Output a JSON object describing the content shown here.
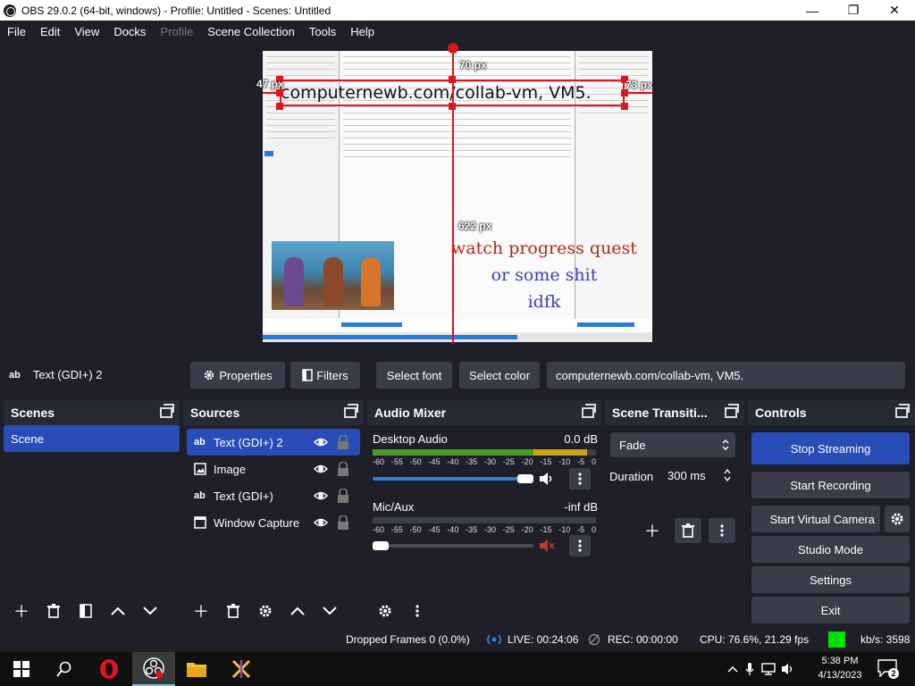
{
  "titlebar": {
    "title": "OBS 29.0.2 (64-bit, windows) - Profile: Untitled - Scenes: Untitled",
    "minimize": "—",
    "maximize": "❐",
    "close": "✕"
  },
  "menu": {
    "file": "File",
    "edit": "Edit",
    "view": "View",
    "docks": "Docks",
    "profile": "Profile",
    "scene_collection": "Scene Collection",
    "tools": "Tools",
    "help": "Help"
  },
  "preview": {
    "text_source": "computernewb.com/collab-vm, VM5.",
    "overlay_line1": "watch progress quest",
    "overlay_line2": "or some shit",
    "overlay_line3": "idfk",
    "dim_top": "70 px",
    "dim_left": "47 px",
    "dim_right": "73 px",
    "dim_bottom": "622 px"
  },
  "source_toolbar": {
    "source_type_icon": "ab",
    "source_name": "Text (GDI+) 2",
    "properties": "Properties",
    "filters": "Filters",
    "select_font": "Select font",
    "select_color": "Select color",
    "text_value": "computernewb.com/collab-vm, VM5."
  },
  "scenes": {
    "header": "Scenes",
    "items": [
      "Scene"
    ]
  },
  "sources": {
    "header": "Sources",
    "items": [
      {
        "name": "Text (GDI+) 2",
        "icon": "ab"
      },
      {
        "name": "Image",
        "icon": "image-icon"
      },
      {
        "name": "Text (GDI+)",
        "icon": "ab"
      },
      {
        "name": "Window Capture",
        "icon": "window-icon"
      }
    ]
  },
  "audio_mixer": {
    "header": "Audio Mixer",
    "channels": [
      {
        "name": "Desktop Audio",
        "level": "0.0 dB",
        "fader_fraction": 1.0,
        "muted": false
      },
      {
        "name": "Mic/Aux",
        "level": "-inf dB",
        "fader_fraction": 0.0,
        "muted": true
      }
    ],
    "scale": [
      "-60",
      "-55",
      "-50",
      "-45",
      "-40",
      "-35",
      "-30",
      "-25",
      "-20",
      "-15",
      "-10",
      "-5",
      "0"
    ]
  },
  "transitions": {
    "header": "Scene Transiti...",
    "selected": "Fade",
    "duration_label": "Duration",
    "duration_value": "300 ms"
  },
  "controls": {
    "header": "Controls",
    "stop_streaming": "Stop Streaming",
    "start_recording": "Start Recording",
    "start_virtual_camera": "Start Virtual Camera",
    "studio_mode": "Studio Mode",
    "settings": "Settings",
    "exit": "Exit"
  },
  "status": {
    "dropped_frames": "Dropped Frames 0 (0.0%)",
    "live": "LIVE: 00:24:06",
    "rec": "REC: 00:00:00",
    "cpu": "CPU: 76.6%, 21.29 fps",
    "kbps": "kb/s: 3598",
    "stream_health_color": "#00e000"
  },
  "taskbar": {
    "time": "5:38 PM",
    "date": "4/13/2023",
    "notification_count": "2"
  },
  "colors": {
    "accent": "#284cb8",
    "dock_bg": "#272a33",
    "panel_bg": "#1e1f29",
    "button_bg": "#3a3c4a",
    "selection_red": "#e0141e"
  }
}
